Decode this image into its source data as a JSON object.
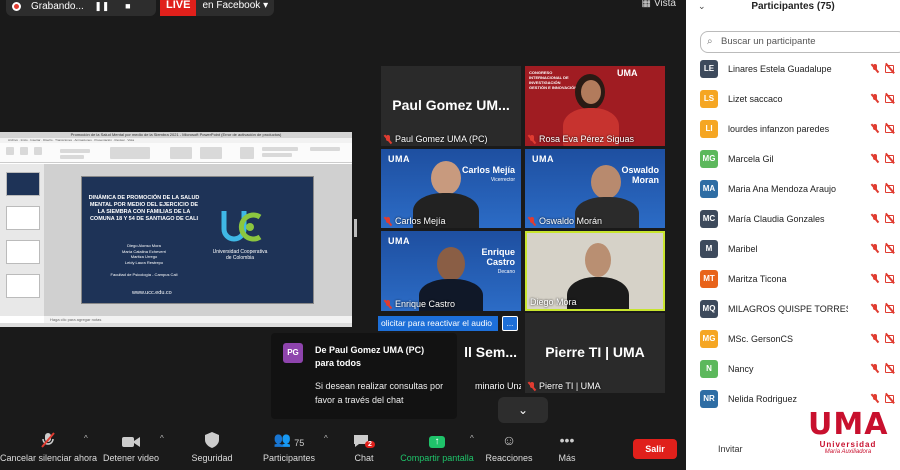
{
  "top": {
    "recording_label": "Grabando...",
    "live_label": "LIVE",
    "live_target": "en Facebook",
    "view_label": "Vista"
  },
  "shared_screen": {
    "window_title": "Promoción de la Salud Mental por medio de la Siembra 2021 - Microsoft PowerPoint (Error de activación de productos)",
    "slide_title": "DINÁMICA DE PROMOCIÓN DE LA SALUD MENTAL POR MEDIO DEL EJERCICIO DE LA SIEMBRA CON FAMILIAS DE LA COMUNA 18 Y 54 DE SANTIAGO DE CALI",
    "slide_authors": [
      "Diego Alonso Mora",
      "María Catalina Echeverri",
      "Maritza Urrego",
      "Leidy Laura Restrepo"
    ],
    "slide_faculty": "Facultad de Psicología - Campus Cali",
    "slide_org": "Universidad Cooperativa de Colombia",
    "slide_web": "www.ucc.edu.co",
    "notes_placeholder": "Haga clic para agregar notas"
  },
  "gallery": {
    "tiles": [
      {
        "id": "paul",
        "big_name": "Paul Gomez UM...",
        "name": "Paul Gomez UMA (PC)",
        "muted": true
      },
      {
        "id": "rosa",
        "name": "Rosa Eva Pérez Siguas",
        "muted": true
      },
      {
        "id": "carlos",
        "name": "Carlos Mejía",
        "muted": true,
        "banner": "Dr. Carlos Mejía",
        "banner_role": "Vicerrector"
      },
      {
        "id": "oswaldo",
        "name": "Oswaldo Morán",
        "muted": true,
        "banner": "Oswaldo Moran"
      },
      {
        "id": "enrique",
        "name": "Enrique Castro",
        "muted": true,
        "banner": "Enrique Castro",
        "banner_role": "Decano"
      },
      {
        "id": "diego",
        "name": "Diego Mora",
        "muted": false
      },
      {
        "id": "seminario",
        "big_name": "ll Sem...",
        "name": "minario Unzu..."
      },
      {
        "id": "pierre",
        "big_name": "Pierre TI | UMA",
        "name": "Pierre TI | UMA",
        "muted": true
      }
    ],
    "uma_mark": "UMA",
    "reactivate_label": "olicitar para reactivar el audio",
    "more_label": "..."
  },
  "notification": {
    "avatar": "PG",
    "from": "De Paul Gomez UMA (PC)",
    "to": "para todos",
    "message": "Si desean realizar consultas por favor a través del chat"
  },
  "toolbar": {
    "mute_label": "Cancelar silenciar ahora",
    "video_label": "Detener video",
    "security_label": "Seguridad",
    "participants_label": "Participantes",
    "participants_count": "75",
    "chat_label": "Chat",
    "chat_badge": "2",
    "share_label": "Compartir pantalla",
    "reactions_label": "Reacciones",
    "more_label": "Más",
    "leave_label": "Salir"
  },
  "panel": {
    "title": "Participantes (75)",
    "search_placeholder": "Buscar un participante",
    "invite_label": "Invitar",
    "participants": [
      {
        "initials": "LE",
        "name": "Linares Estela Guadalupe",
        "color": "#3d4a5c"
      },
      {
        "initials": "LS",
        "name": "Lizet saccaco",
        "color": "#f5a623"
      },
      {
        "initials": "LI",
        "name": "lourdes infanzon paredes",
        "color": "#f5a623"
      },
      {
        "initials": "MG",
        "name": "Marcela Gil",
        "color": "#5cb85c"
      },
      {
        "initials": "MA",
        "name": "Maria Ana Mendoza Araujo",
        "color": "#2e6da4"
      },
      {
        "initials": "MC",
        "name": "María Claudia Gonzales",
        "color": "#3d4a5c"
      },
      {
        "initials": "M",
        "name": "Maribel",
        "color": "#3d4a5c"
      },
      {
        "initials": "MT",
        "name": "Maritza Ticona",
        "color": "#e8631a"
      },
      {
        "initials": "MQ",
        "name": "MILAGROS QUISPE TORRES",
        "color": "#3d4a5c"
      },
      {
        "initials": "MG",
        "name": "MSc. GersonCS",
        "color": "#f5a623"
      },
      {
        "initials": "N",
        "name": "Nancy",
        "color": "#5cb85c"
      },
      {
        "initials": "NR",
        "name": "Nelida Rodriguez",
        "color": "#2e6da4"
      }
    ]
  },
  "branding": {
    "logo": "UMA",
    "logo_sub": "Universidad",
    "logo_sub2": "María Auxiliadora",
    "accent": "#c8102e"
  }
}
